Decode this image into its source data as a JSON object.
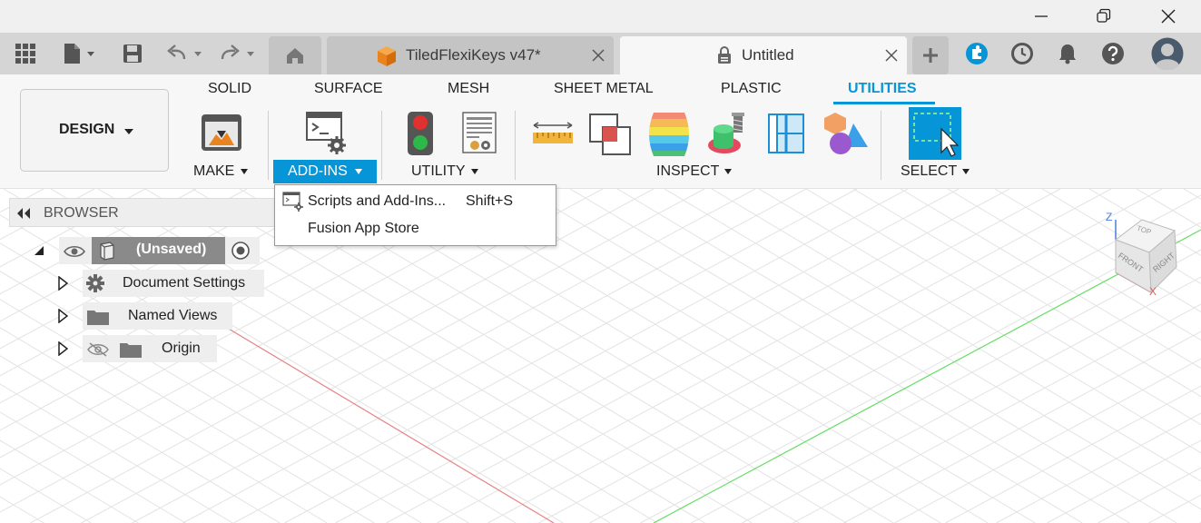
{
  "window": {
    "minimize_icon": "minimize-icon",
    "restore_icon": "restore-icon",
    "close_icon": "close-icon"
  },
  "tabs": {
    "inactive_title": "TiledFlexiKeys v47*",
    "active_title": "Untitled"
  },
  "ribbon": {
    "workspace_label": "DESIGN",
    "tabs": [
      "SOLID",
      "SURFACE",
      "MESH",
      "SHEET METAL",
      "PLASTIC",
      "UTILITIES"
    ],
    "active_tab": "UTILITIES",
    "groups": {
      "make": "MAKE",
      "addins": "ADD-INS",
      "utility": "UTILITY",
      "inspect": "INSPECT",
      "select": "SELECT"
    }
  },
  "dropdown": {
    "items": [
      {
        "label": "Scripts and Add-Ins...",
        "shortcut": "Shift+S"
      },
      {
        "label": "Fusion App Store",
        "shortcut": ""
      }
    ]
  },
  "browser": {
    "title": "BROWSER",
    "root": "(Unsaved)",
    "nodes": [
      "Document Settings",
      "Named Views",
      "Origin"
    ]
  },
  "viewcube": {
    "top": "TOP",
    "front": "FRONT",
    "right": "RIGHT",
    "axis_z": "Z",
    "axis_x": "X"
  },
  "colors": {
    "accent": "#0696d7",
    "axis_red": "#e06666",
    "axis_green": "#6fd36f",
    "tab_bar": "#d5d5d5"
  }
}
